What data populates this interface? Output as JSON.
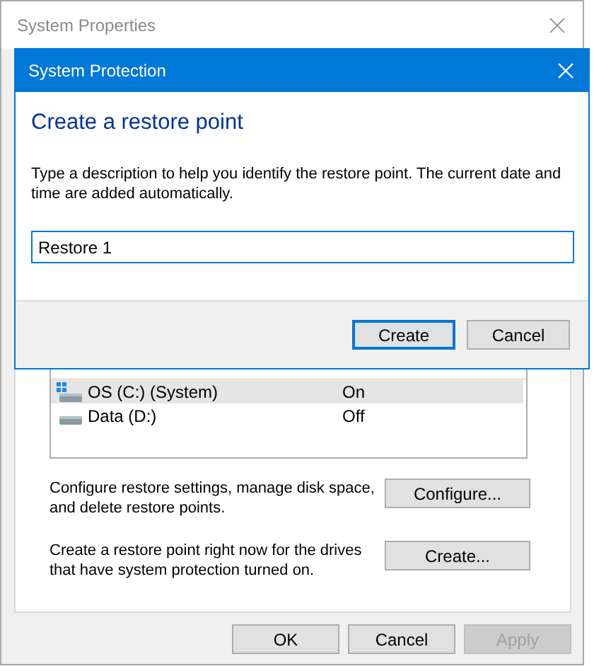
{
  "background_window": {
    "title": "System Properties",
    "drives": [
      {
        "name": "OS (C:) (System)",
        "protection": "On",
        "selected": true,
        "kind": "system"
      },
      {
        "name": "Data (D:)",
        "protection": "Off",
        "selected": false,
        "kind": "data"
      }
    ],
    "actions": [
      {
        "description": "Configure restore settings, manage disk space, and delete restore points.",
        "button": "Configure..."
      },
      {
        "description": "Create a restore point right now for the drives that have system protection turned on.",
        "button": "Create..."
      }
    ],
    "buttons": [
      {
        "label": "OK",
        "disabled": false
      },
      {
        "label": "Cancel",
        "disabled": false
      },
      {
        "label": "Apply",
        "disabled": true
      }
    ]
  },
  "dialog": {
    "title": "System Protection",
    "heading": "Create a restore point",
    "description": "Type a description to help you identify the restore point. The current date and time are added automatically.",
    "input": {
      "value": "Restore 1"
    },
    "buttons": [
      {
        "label": "Create",
        "default": true
      },
      {
        "label": "Cancel",
        "default": false
      }
    ]
  }
}
